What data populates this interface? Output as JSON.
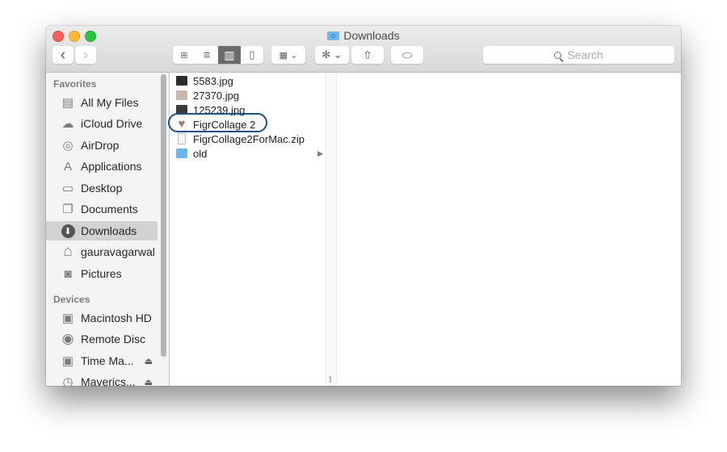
{
  "window": {
    "title": "Downloads",
    "title_icon": "downloads-folder-icon"
  },
  "toolbar": {
    "back_label": "‹",
    "forward_label": "›",
    "view_modes": [
      {
        "name": "icon-view",
        "glyph": "⊞",
        "active": false
      },
      {
        "name": "list-view",
        "glyph": "≡",
        "active": false
      },
      {
        "name": "column-view",
        "glyph": "▥",
        "active": true
      },
      {
        "name": "cover-flow-view",
        "glyph": "▯",
        "active": false
      }
    ],
    "arrange_label": "▦ ⌄",
    "action_label": "✻ ⌄",
    "share_label": "⇧",
    "tag_label": "⬭",
    "search_placeholder": "Search"
  },
  "sidebar": {
    "favorites_header": "Favorites",
    "favorites": [
      {
        "label": "All My Files",
        "icon": "all-my-files-icon",
        "glyph": "▤"
      },
      {
        "label": "iCloud Drive",
        "icon": "cloud-icon",
        "glyph": "☁"
      },
      {
        "label": "AirDrop",
        "icon": "airdrop-icon",
        "glyph": "◎"
      },
      {
        "label": "Applications",
        "icon": "applications-icon",
        "glyph": "A"
      },
      {
        "label": "Desktop",
        "icon": "desktop-icon",
        "glyph": "▭"
      },
      {
        "label": "Documents",
        "icon": "documents-icon",
        "glyph": "❐"
      },
      {
        "label": "Downloads",
        "icon": "downloads-icon",
        "glyph": "⬇",
        "selected": true
      },
      {
        "label": "gauravagarwal",
        "icon": "home-icon",
        "glyph": "⌂"
      },
      {
        "label": "Pictures",
        "icon": "camera-icon",
        "glyph": "◙"
      }
    ],
    "devices_header": "Devices",
    "devices": [
      {
        "label": "Macintosh HD",
        "icon": "hard-drive-icon",
        "glyph": "▣"
      },
      {
        "label": "Remote Disc",
        "icon": "disc-icon",
        "glyph": "◉"
      },
      {
        "label": "Time Ma...",
        "icon": "hard-drive-icon",
        "glyph": "▣",
        "eject": "⏏"
      },
      {
        "label": "Maverics...",
        "icon": "time-machine-icon",
        "glyph": "◷",
        "eject": "⏏"
      }
    ]
  },
  "files": [
    {
      "name": "5583.jpg",
      "icon": "image-thumbnail-icon",
      "color": "#2b2b2b"
    },
    {
      "name": "27370.jpg",
      "icon": "image-thumbnail-icon",
      "color": "#c9b8b0"
    },
    {
      "name": "125239.jpg",
      "icon": "image-thumbnail-icon",
      "color": "#3a3a3a"
    },
    {
      "name": "FigrCollage 2",
      "icon": "app-heart-collage-icon",
      "color": "#9a8470",
      "highlighted": true
    },
    {
      "name": "FigrCollage2ForMac.zip",
      "icon": "zip-file-icon",
      "color": "#f4f4f4"
    },
    {
      "name": "old",
      "icon": "folder-icon",
      "color": "#6bb7ec",
      "has_children": true,
      "arrow": "▶"
    }
  ],
  "column_resize_grip": "||"
}
